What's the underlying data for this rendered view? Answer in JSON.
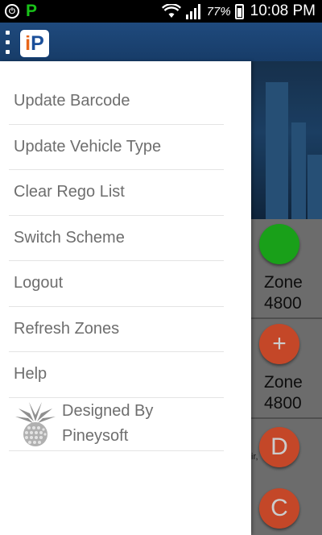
{
  "status_bar": {
    "notification_icons": [
      "sync-icon",
      "parking-app-icon"
    ],
    "p_letter": "P",
    "battery_percent": "77%",
    "clock": "10:08 PM",
    "battery_level": 0.77
  },
  "app_bar": {
    "logo_i": "i",
    "logo_p": "P"
  },
  "drawer": {
    "items": [
      {
        "label": "Update Barcode"
      },
      {
        "label": "Update Vehicle Type"
      },
      {
        "label": "Clear Rego List"
      },
      {
        "label": "Switch Scheme"
      },
      {
        "label": "Logout"
      },
      {
        "label": "Refresh Zones"
      },
      {
        "label": "Help"
      }
    ],
    "footer": {
      "line1": "Designed By",
      "line2": "Pineysoft"
    }
  },
  "background_list": {
    "zones": [
      {
        "icon": "",
        "color": "#1db71d",
        "name": "Zone",
        "number": "4800"
      },
      {
        "icon": "+",
        "color": "#e0512e",
        "name": "Zone",
        "number": "4800"
      }
    ],
    "badges": [
      {
        "letter": "D",
        "color": "#e0512e"
      },
      {
        "letter": "C",
        "color": "#e0512e"
      }
    ],
    "snippet": "ir,"
  },
  "colors": {
    "appbar": "#1f4a7d",
    "drawer_text": "#6e6e6e",
    "accent_orange": "#e0512e",
    "accent_green": "#1db71d"
  }
}
